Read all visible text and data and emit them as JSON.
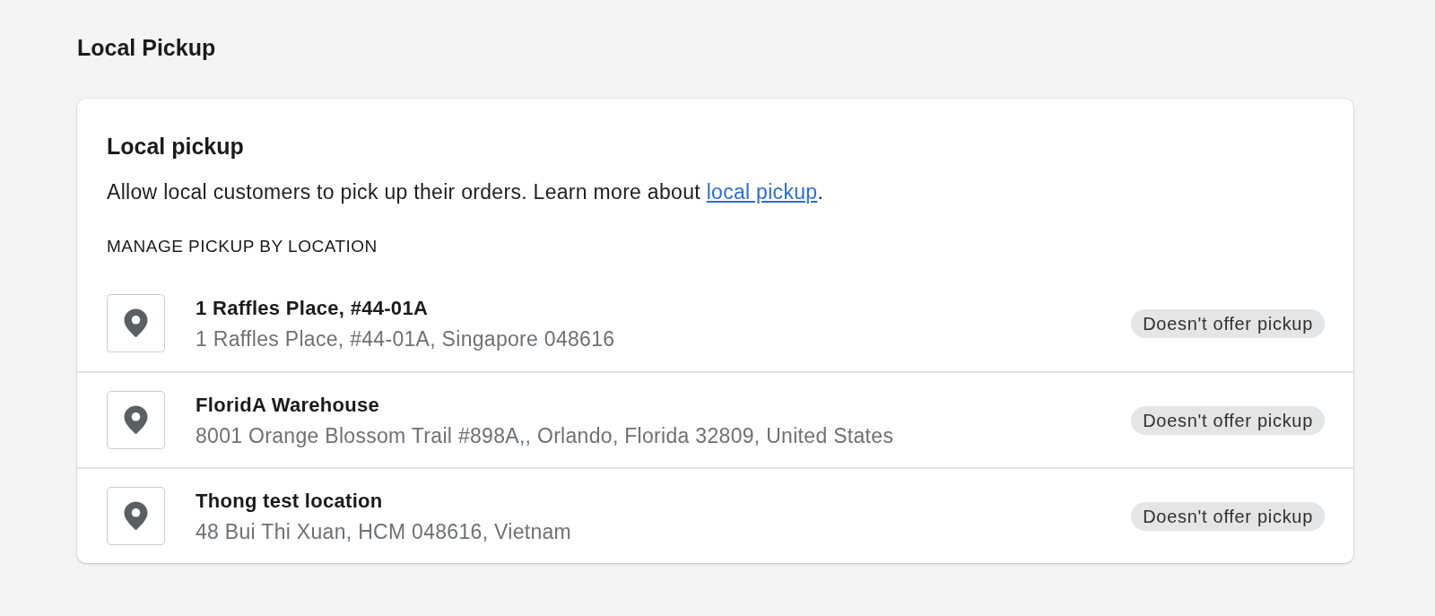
{
  "page": {
    "title": "Local Pickup"
  },
  "card": {
    "title": "Local pickup",
    "description": {
      "text": "Allow local customers to pick up their orders. Learn more about ",
      "link": "local pickup",
      "suffix": "."
    },
    "section_heading": "MANAGE PICKUP BY LOCATION",
    "locations": [
      {
        "name": "1 Raffles Place, #44-01A",
        "address": "1 Raffles Place, #44-01A, Singapore 048616",
        "status": "Doesn't offer pickup"
      },
      {
        "name": "FloridA Warehouse",
        "address": "8001 Orange Blossom Trail #898A,, Orlando, Florida 32809, United States",
        "status": "Doesn't offer pickup"
      },
      {
        "name": "Thong test location",
        "address": "48 Bui Thi Xuan, HCM 048616, Vietnam",
        "status": "Doesn't offer pickup"
      }
    ]
  }
}
